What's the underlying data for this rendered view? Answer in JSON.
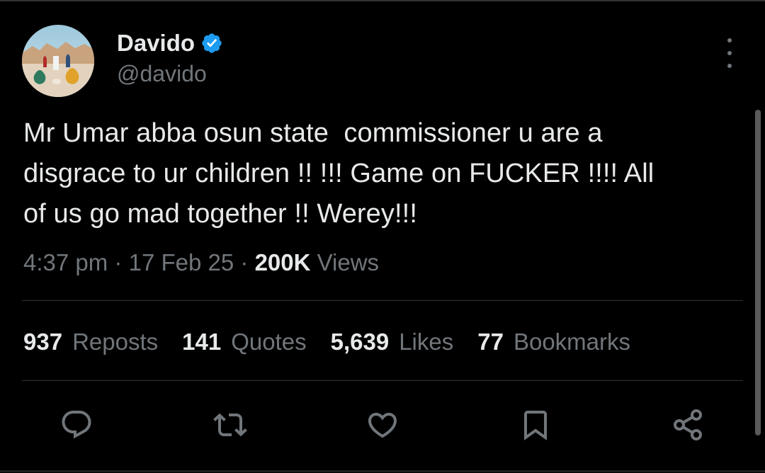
{
  "author": {
    "display_name": "Davido",
    "handle": "@davido",
    "verified": true,
    "avatar_icon": "profile-photo"
  },
  "tweet": {
    "text": "Mr Umar abba osun state  commissioner u are a\ndisgrace to ur children !! !!! Game on FUCKER !!!! All\nof us go mad together !! Werey!!!"
  },
  "meta": {
    "time": "4:37 pm",
    "separator": "·",
    "date": "17 Feb 25",
    "views_count": "200K",
    "views_label": "Views"
  },
  "stats": [
    {
      "count": "937",
      "label": "Reposts"
    },
    {
      "count": "141",
      "label": "Quotes"
    },
    {
      "count": "5,639",
      "label": "Likes"
    },
    {
      "count": "77",
      "label": "Bookmarks"
    }
  ],
  "actions": [
    {
      "name": "reply",
      "icon": "reply-icon"
    },
    {
      "name": "repost",
      "icon": "repost-icon"
    },
    {
      "name": "like",
      "icon": "heart-icon"
    },
    {
      "name": "bookmark",
      "icon": "bookmark-icon"
    },
    {
      "name": "share",
      "icon": "share-icon"
    }
  ],
  "colors": {
    "background": "#000000",
    "text_primary": "#e7e9ea",
    "text_secondary": "#71767b",
    "verified_blue": "#1d9bf0",
    "divider": "#2f3336"
  }
}
